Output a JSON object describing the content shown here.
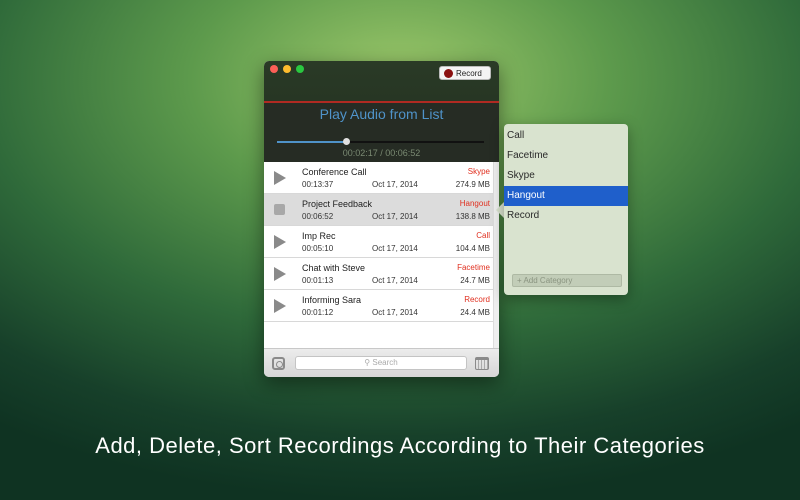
{
  "window": {
    "record_label": "Record"
  },
  "player": {
    "title": "Play Audio from List",
    "time": "00:02:17 /  00:06:52",
    "progress_fraction": 0.333
  },
  "recordings": [
    {
      "name": "Conference Call",
      "duration": "00:13:37",
      "date": "Oct 17, 2014",
      "size": "274.9 MB",
      "category": "Skype",
      "state": "play"
    },
    {
      "name": "Project Feedback",
      "duration": "00:06:52",
      "date": "Oct 17, 2014",
      "size": "138.8 MB",
      "category": "Hangout",
      "state": "stop"
    },
    {
      "name": "Imp Rec",
      "duration": "00:05:10",
      "date": "Oct 17, 2014",
      "size": "104.4 MB",
      "category": "Call",
      "state": "play"
    },
    {
      "name": "Chat with Steve",
      "duration": "00:01:13",
      "date": "Oct 17, 2014",
      "size": "24.7 MB",
      "category": "Facetime",
      "state": "play"
    },
    {
      "name": "Informing Sara",
      "duration": "00:01:12",
      "date": "Oct 17, 2014",
      "size": "24.4 MB",
      "category": "Record",
      "state": "play"
    }
  ],
  "footer": {
    "search_placeholder": "Search"
  },
  "categories": {
    "items": [
      "Call",
      "Facetime",
      "Skype",
      "Hangout",
      "Record"
    ],
    "selected": "Hangout",
    "add_label": "+ Add Category"
  },
  "caption": "Add, Delete, Sort Recordings According to Their Categories",
  "colors": {
    "accent_blue": "#4f93c9",
    "category_red": "#e03020",
    "selection_blue": "#1f5fcb"
  }
}
